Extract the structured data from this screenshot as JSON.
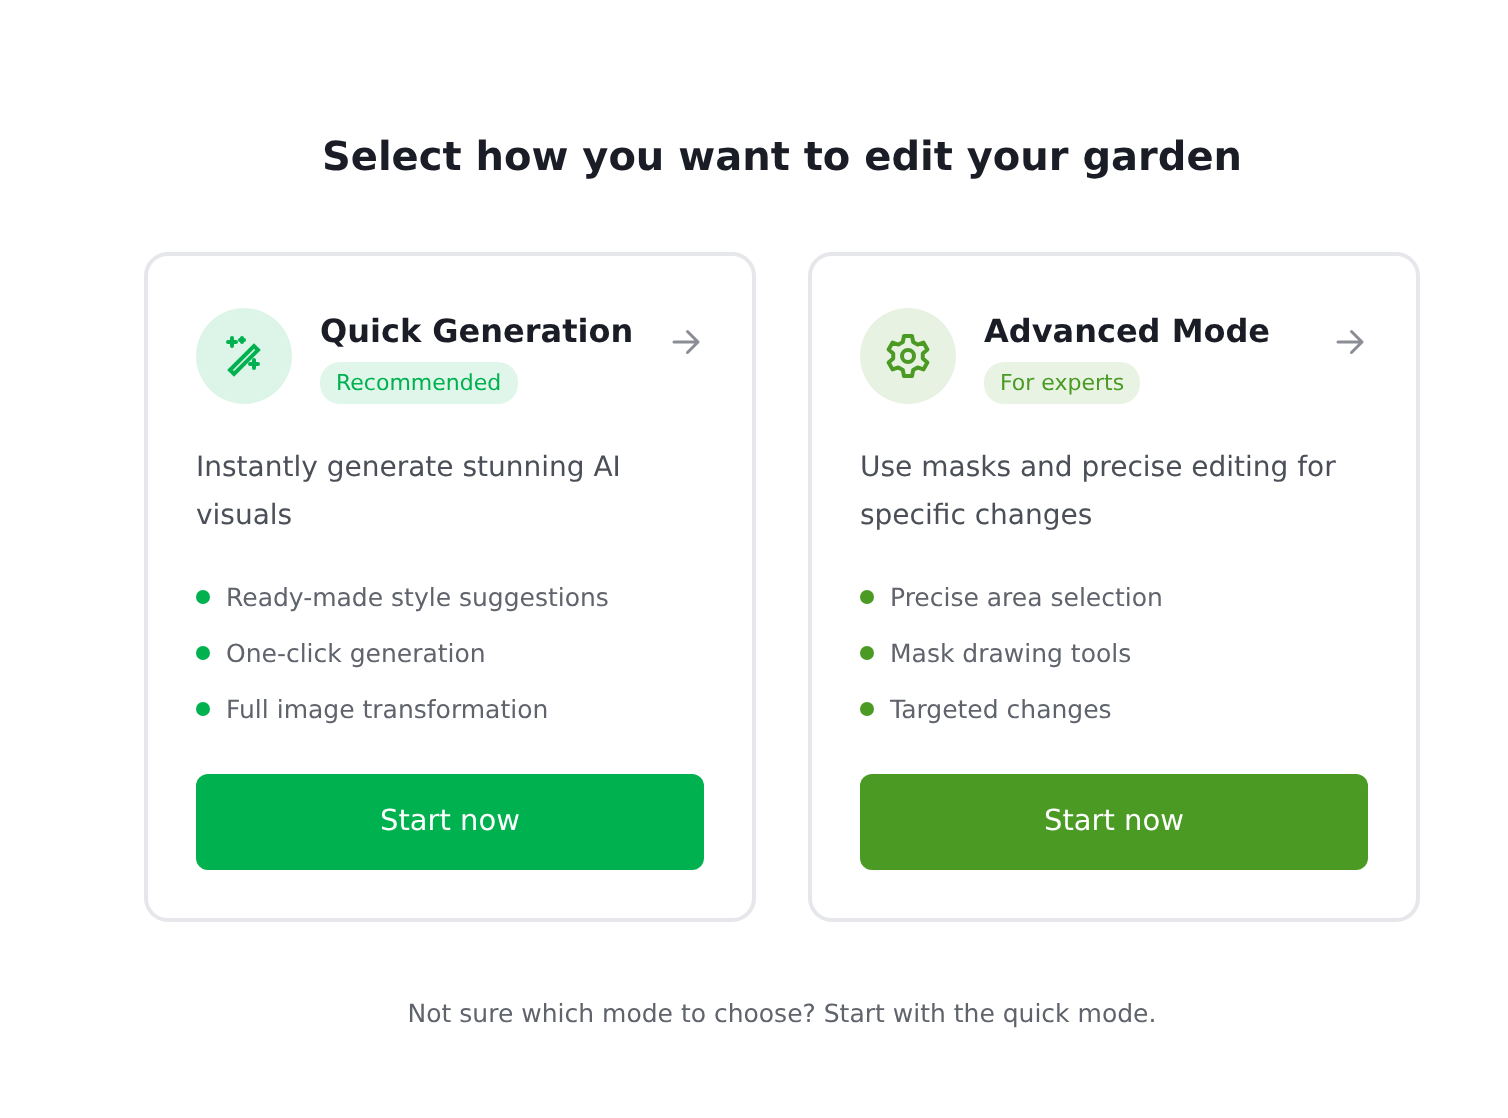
{
  "heading": "Select how you want to edit your garden",
  "cards": [
    {
      "kind": "wand",
      "title": "Quick Generation",
      "badge": "Recommended",
      "color": "#00b14f",
      "description": "Instantly generate stunning AI visuals",
      "features": [
        "Ready-made style suggestions",
        "One-click generation",
        "Full image transformation"
      ],
      "button": "Start now"
    },
    {
      "kind": "gear",
      "title": "Advanced Mode",
      "badge": "For experts",
      "color": "#4a9a24",
      "description": "Use masks and precise editing for specific changes",
      "features": [
        "Precise area selection",
        "Mask drawing tools",
        "Targeted changes"
      ],
      "button": "Start now"
    }
  ],
  "footer": "Not sure which mode to choose? Start with the quick mode."
}
